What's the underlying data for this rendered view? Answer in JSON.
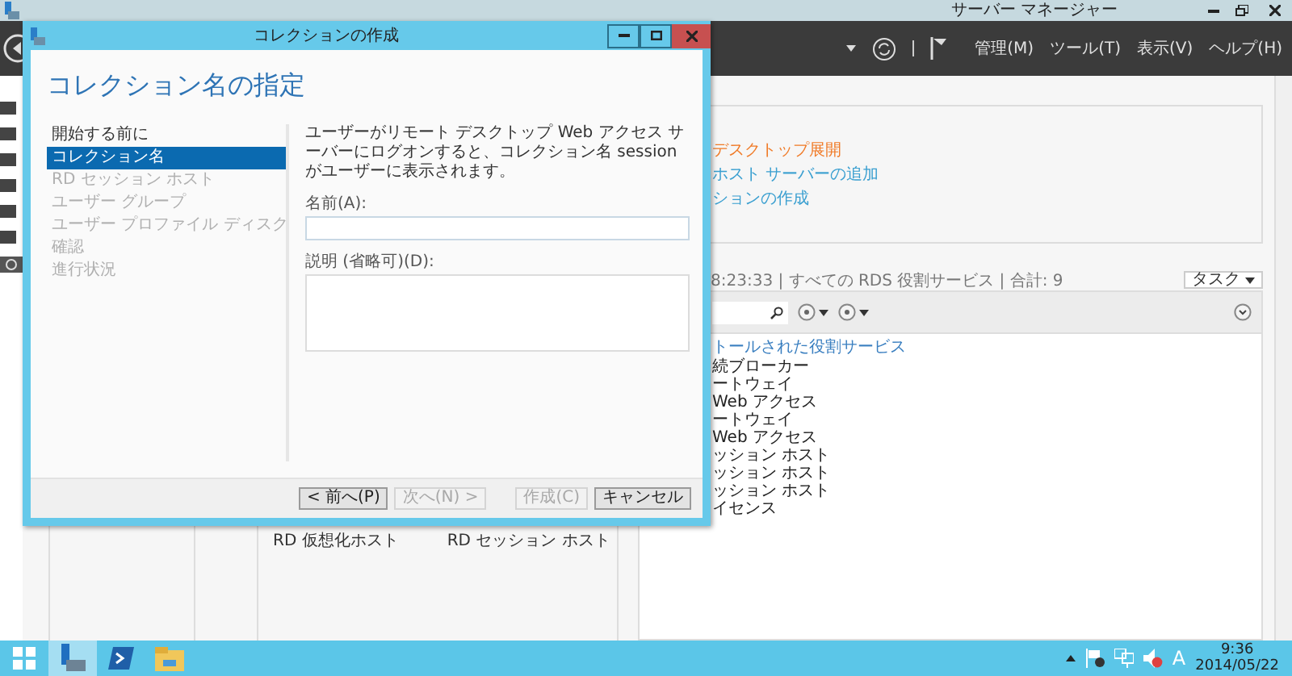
{
  "server_manager": {
    "title": "サーバー マネージャー",
    "menus": [
      "管理(M)",
      "ツール(T)",
      "表示(V)",
      "ヘルプ(H)"
    ],
    "overview_links": [
      {
        "text": "デスクトップ展開",
        "kind": "highlight"
      },
      {
        "text": "ホスト サーバーの追加",
        "kind": "link"
      },
      {
        "text": "ションの作成",
        "kind": "link"
      }
    ],
    "roles": {
      "info": "8:23:33 | すべての RDS 役割サービス | 合計: 9",
      "tasks_button": "タスク",
      "group": "トールされた役割サービス",
      "items": [
        "続ブローカー",
        "ートウェイ",
        "Web アクセス",
        "ートウェイ",
        "Web アクセス",
        "ッション ホスト",
        "ッション ホスト",
        "ッション ホスト",
        "イセンス"
      ]
    },
    "bottom_labels": [
      "RD 仮想化ホスト",
      "RD セッション ホスト"
    ]
  },
  "dialog": {
    "title": "コレクションの作成",
    "heading": "コレクション名の指定",
    "steps": [
      {
        "label": "開始する前に",
        "selected": false,
        "disabled": false
      },
      {
        "label": "コレクション名",
        "selected": true,
        "disabled": false
      },
      {
        "label": "RD セッション ホスト",
        "selected": false,
        "disabled": true
      },
      {
        "label": "ユーザー グループ",
        "selected": false,
        "disabled": true
      },
      {
        "label": "ユーザー プロファイル ディスク",
        "selected": false,
        "disabled": true
      },
      {
        "label": "確認",
        "selected": false,
        "disabled": true
      },
      {
        "label": "進行状況",
        "selected": false,
        "disabled": true
      }
    ],
    "description": "ユーザーがリモート デスクトップ Web アクセス サーバーにログオンすると、コレクション名 session がユーザーに表示されます。",
    "name_label": "名前(A):",
    "description_label": "説明 (省略可)(D):",
    "buttons": [
      {
        "label": "< 前へ(P)",
        "disabled": false,
        "kind": "nav"
      },
      {
        "label": "次へ(N) >",
        "disabled": true,
        "kind": "nav"
      },
      {
        "label": "作成(C)",
        "disabled": true,
        "kind": "action"
      },
      {
        "label": "キャンセル",
        "disabled": false,
        "kind": "action"
      }
    ]
  },
  "taskbar": {
    "ime": "A",
    "time": "9:36",
    "date": "2014/05/22"
  }
}
